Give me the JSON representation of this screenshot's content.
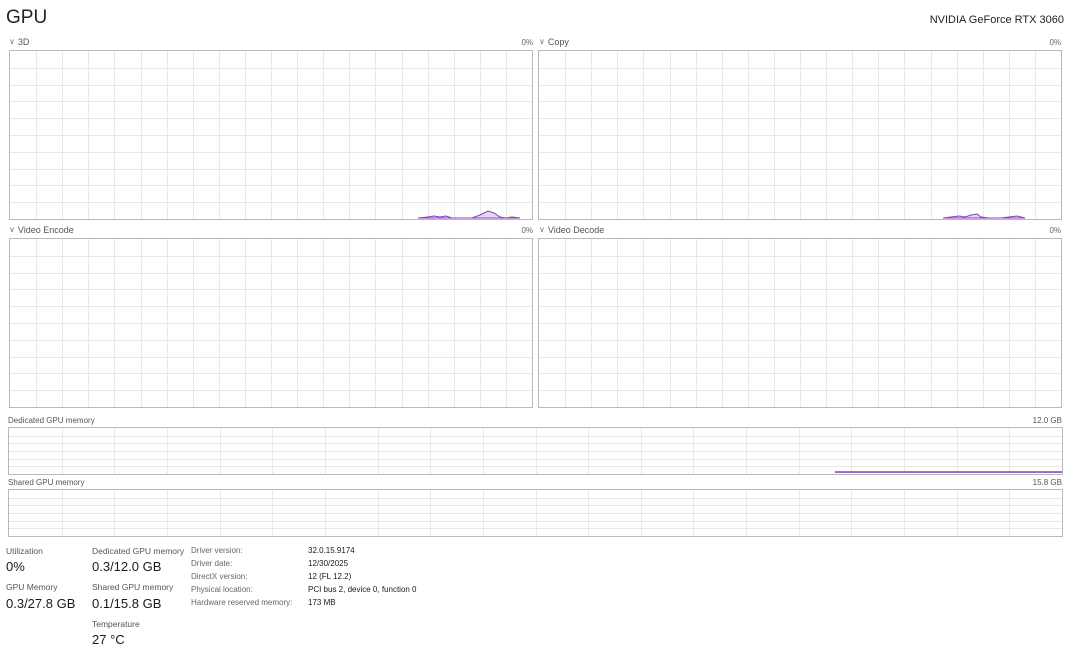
{
  "header": {
    "title": "GPU",
    "device_name": "NVIDIA GeForce RTX 3060"
  },
  "engines": [
    {
      "label": "3D",
      "percent": "0%",
      "expanded": true
    },
    {
      "label": "Copy",
      "percent": "0%",
      "expanded": true
    },
    {
      "label": "Video Encode",
      "percent": "0%",
      "expanded": true
    },
    {
      "label": "Video Decode",
      "percent": "0%",
      "expanded": true
    }
  ],
  "memory_graphs": {
    "dedicated": {
      "label": "Dedicated GPU memory",
      "max": "12.0 GB"
    },
    "shared": {
      "label": "Shared GPU memory",
      "max": "15.8 GB"
    }
  },
  "stats": {
    "utilization": {
      "label": "Utilization",
      "value": "0%"
    },
    "dedicated_memory": {
      "label": "Dedicated GPU memory",
      "value": "0.3/12.0 GB"
    },
    "gpu_memory": {
      "label": "GPU Memory",
      "value": "0.3/27.8 GB"
    },
    "shared_memory": {
      "label": "Shared GPU memory",
      "value": "0.1/15.8 GB"
    },
    "temperature": {
      "label": "Temperature",
      "value": "27 °C"
    }
  },
  "details": {
    "driver_version": {
      "key": "Driver version:",
      "value": "32.0.15.9174"
    },
    "driver_date": {
      "key": "Driver date:",
      "value": "12/30/2025"
    },
    "directx_version": {
      "key": "DirectX version:",
      "value": "12 (FL 12.2)"
    },
    "physical_location": {
      "key": "Physical location:",
      "value": "PCI bus 2, device 0, function 0"
    },
    "hardware_reserved": {
      "key": "Hardware reserved memory:",
      "value": "173 MB"
    }
  },
  "colors": {
    "graph_line": "#8b3fbf",
    "graph_fill": "#e7d6f3",
    "grid": "#e8e8e8",
    "border": "#b9b9b9"
  }
}
